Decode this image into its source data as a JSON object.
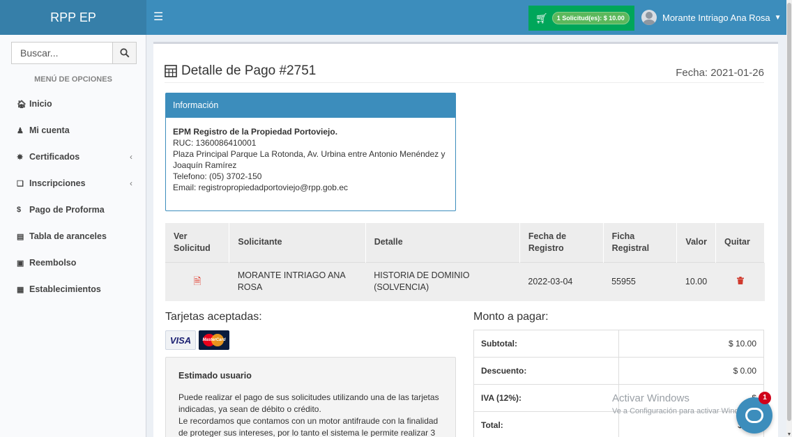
{
  "brand": "RPP EP",
  "header": {
    "cart_label": "1 Solicitud(es): $ 10.00",
    "user_name": "Morante Intriago Ana Rosa"
  },
  "sidebar": {
    "search_placeholder": "Buscar...",
    "menu_header": "MENÚ DE OPCIONES",
    "items": [
      {
        "label": "Inicio"
      },
      {
        "label": "Mi cuenta"
      },
      {
        "label": "Certificados"
      },
      {
        "label": "Inscripciones"
      },
      {
        "label": "Pago de Proforma"
      },
      {
        "label": "Tabla de aranceles"
      },
      {
        "label": "Reembolso"
      },
      {
        "label": "Establecimientos"
      }
    ]
  },
  "page": {
    "title": "Detalle de Pago #2751",
    "fecha": "Fecha: 2021-01-26"
  },
  "info": {
    "header": "Información",
    "company": "EPM Registro de la Propiedad Portoviejo.",
    "ruc": "RUC: 1360086410001",
    "address1": "Plaza Principal Parque La Rotonda, Av. Urbina entre Antonio Menéndez y",
    "address2": "Joaquín Ramírez",
    "phone": "Telefono: (05) 3702-150",
    "email": "Email: registropropiedadportoviejo@rpp.gob.ec"
  },
  "table": {
    "headers": [
      "Ver Solicitud",
      "Solicitante",
      "Detalle",
      "Fecha de Registro",
      "Ficha Registral",
      "Valor",
      "Quitar"
    ],
    "rows": [
      {
        "solicitante": "MORANTE INTRIAGO ANA ROSA",
        "detalle": "HISTORIA DE DOMINIO (SOLVENCIA)",
        "fecha": "2022-03-04",
        "ficha": "55955",
        "valor": "10.00"
      }
    ]
  },
  "tarjetas": {
    "title": "Tarjetas aceptadas:",
    "visa": "VISA",
    "mastercard": "MasterCard"
  },
  "notice": {
    "title": "Estimado usuario",
    "p1": "Puede realizar el pago de sus solicitudes utilizando una de las tarjetas indicadas, ya sean de débito o crédito.",
    "p2": "Le recordamos que contamos con un motor antifraude con la finalidad de proteger sus intereses, por lo tanto el sistema le permite realizar 3"
  },
  "monto": {
    "title": "Monto a pagar:",
    "rows": [
      {
        "label": "Subtotal:",
        "value": "$ 10.00"
      },
      {
        "label": "Descuento:",
        "value": "$ 0.00"
      },
      {
        "label": "IVA (12%):",
        "value": "$"
      },
      {
        "label": "Total:",
        "value": "$ 10."
      }
    ]
  },
  "watermark": {
    "line1": "Activar Windows",
    "line2": "Ve a Configuración para activar Windows."
  },
  "chat_badge": "1",
  "colors": {
    "primary": "#3c8dbc",
    "success": "#00a65a",
    "danger": "#d03a2e"
  }
}
